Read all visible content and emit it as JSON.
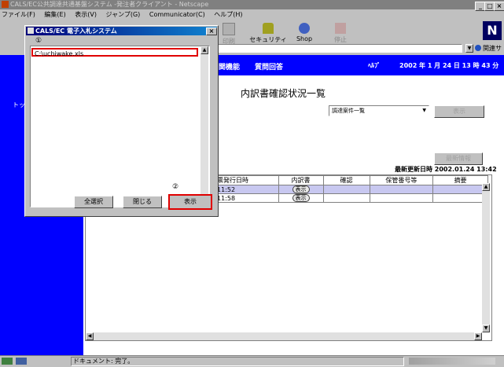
{
  "browser": {
    "title": "CALS/EC公共調達共通基盤システム -発注者クライアント - Netscape",
    "menu": [
      "ファイル(F)",
      "編集(E)",
      "表示(V)",
      "ジャンプ(G)",
      "Communicator(C)",
      "ヘルプ(H)"
    ],
    "toolbar": [
      {
        "label": "印刷",
        "icon": "print-icon"
      },
      {
        "label": "セキュリティ",
        "icon": "security-icon"
      },
      {
        "label": "Shop",
        "icon": "shop-icon"
      },
      {
        "label": "停止",
        "icon": "stop-icon"
      }
    ],
    "related_sites": "関連サイト",
    "left_label": "トッ",
    "status_text": "ドキュメント: 完了。"
  },
  "page": {
    "nav": [
      "関機能",
      "質問回答"
    ],
    "help": "ﾍﾙﾌﾟ",
    "datetime": "2002 年  1 月 24 日   13 時 43 分",
    "heading": "内訳書確認状況一覧",
    "select_value": "調達案件一覧",
    "display_button": "表示",
    "refresh_button": "最新情報",
    "last_updated": "最新更新日時 2002.01.24 13:42",
    "columns": [
      "票発行日時",
      "内訳書",
      "確認",
      "保管番号等",
      "摘要"
    ],
    "rows": [
      {
        "time": "11:52",
        "action": "表示"
      },
      {
        "time": "11:58",
        "action": "表示"
      }
    ]
  },
  "dialog": {
    "title": "CALS/EC 電子入札システム",
    "marker1": "①",
    "marker2": "②",
    "file_item": "C:\\uchiwake.xls",
    "select_all": "全選択",
    "close": "閉じる",
    "display": "表示"
  },
  "colors": {
    "title_bar": "#00007b",
    "nav_blue": "#0000ff",
    "highlight_red": "#e00000",
    "selected_row": "#c8c8f0"
  }
}
